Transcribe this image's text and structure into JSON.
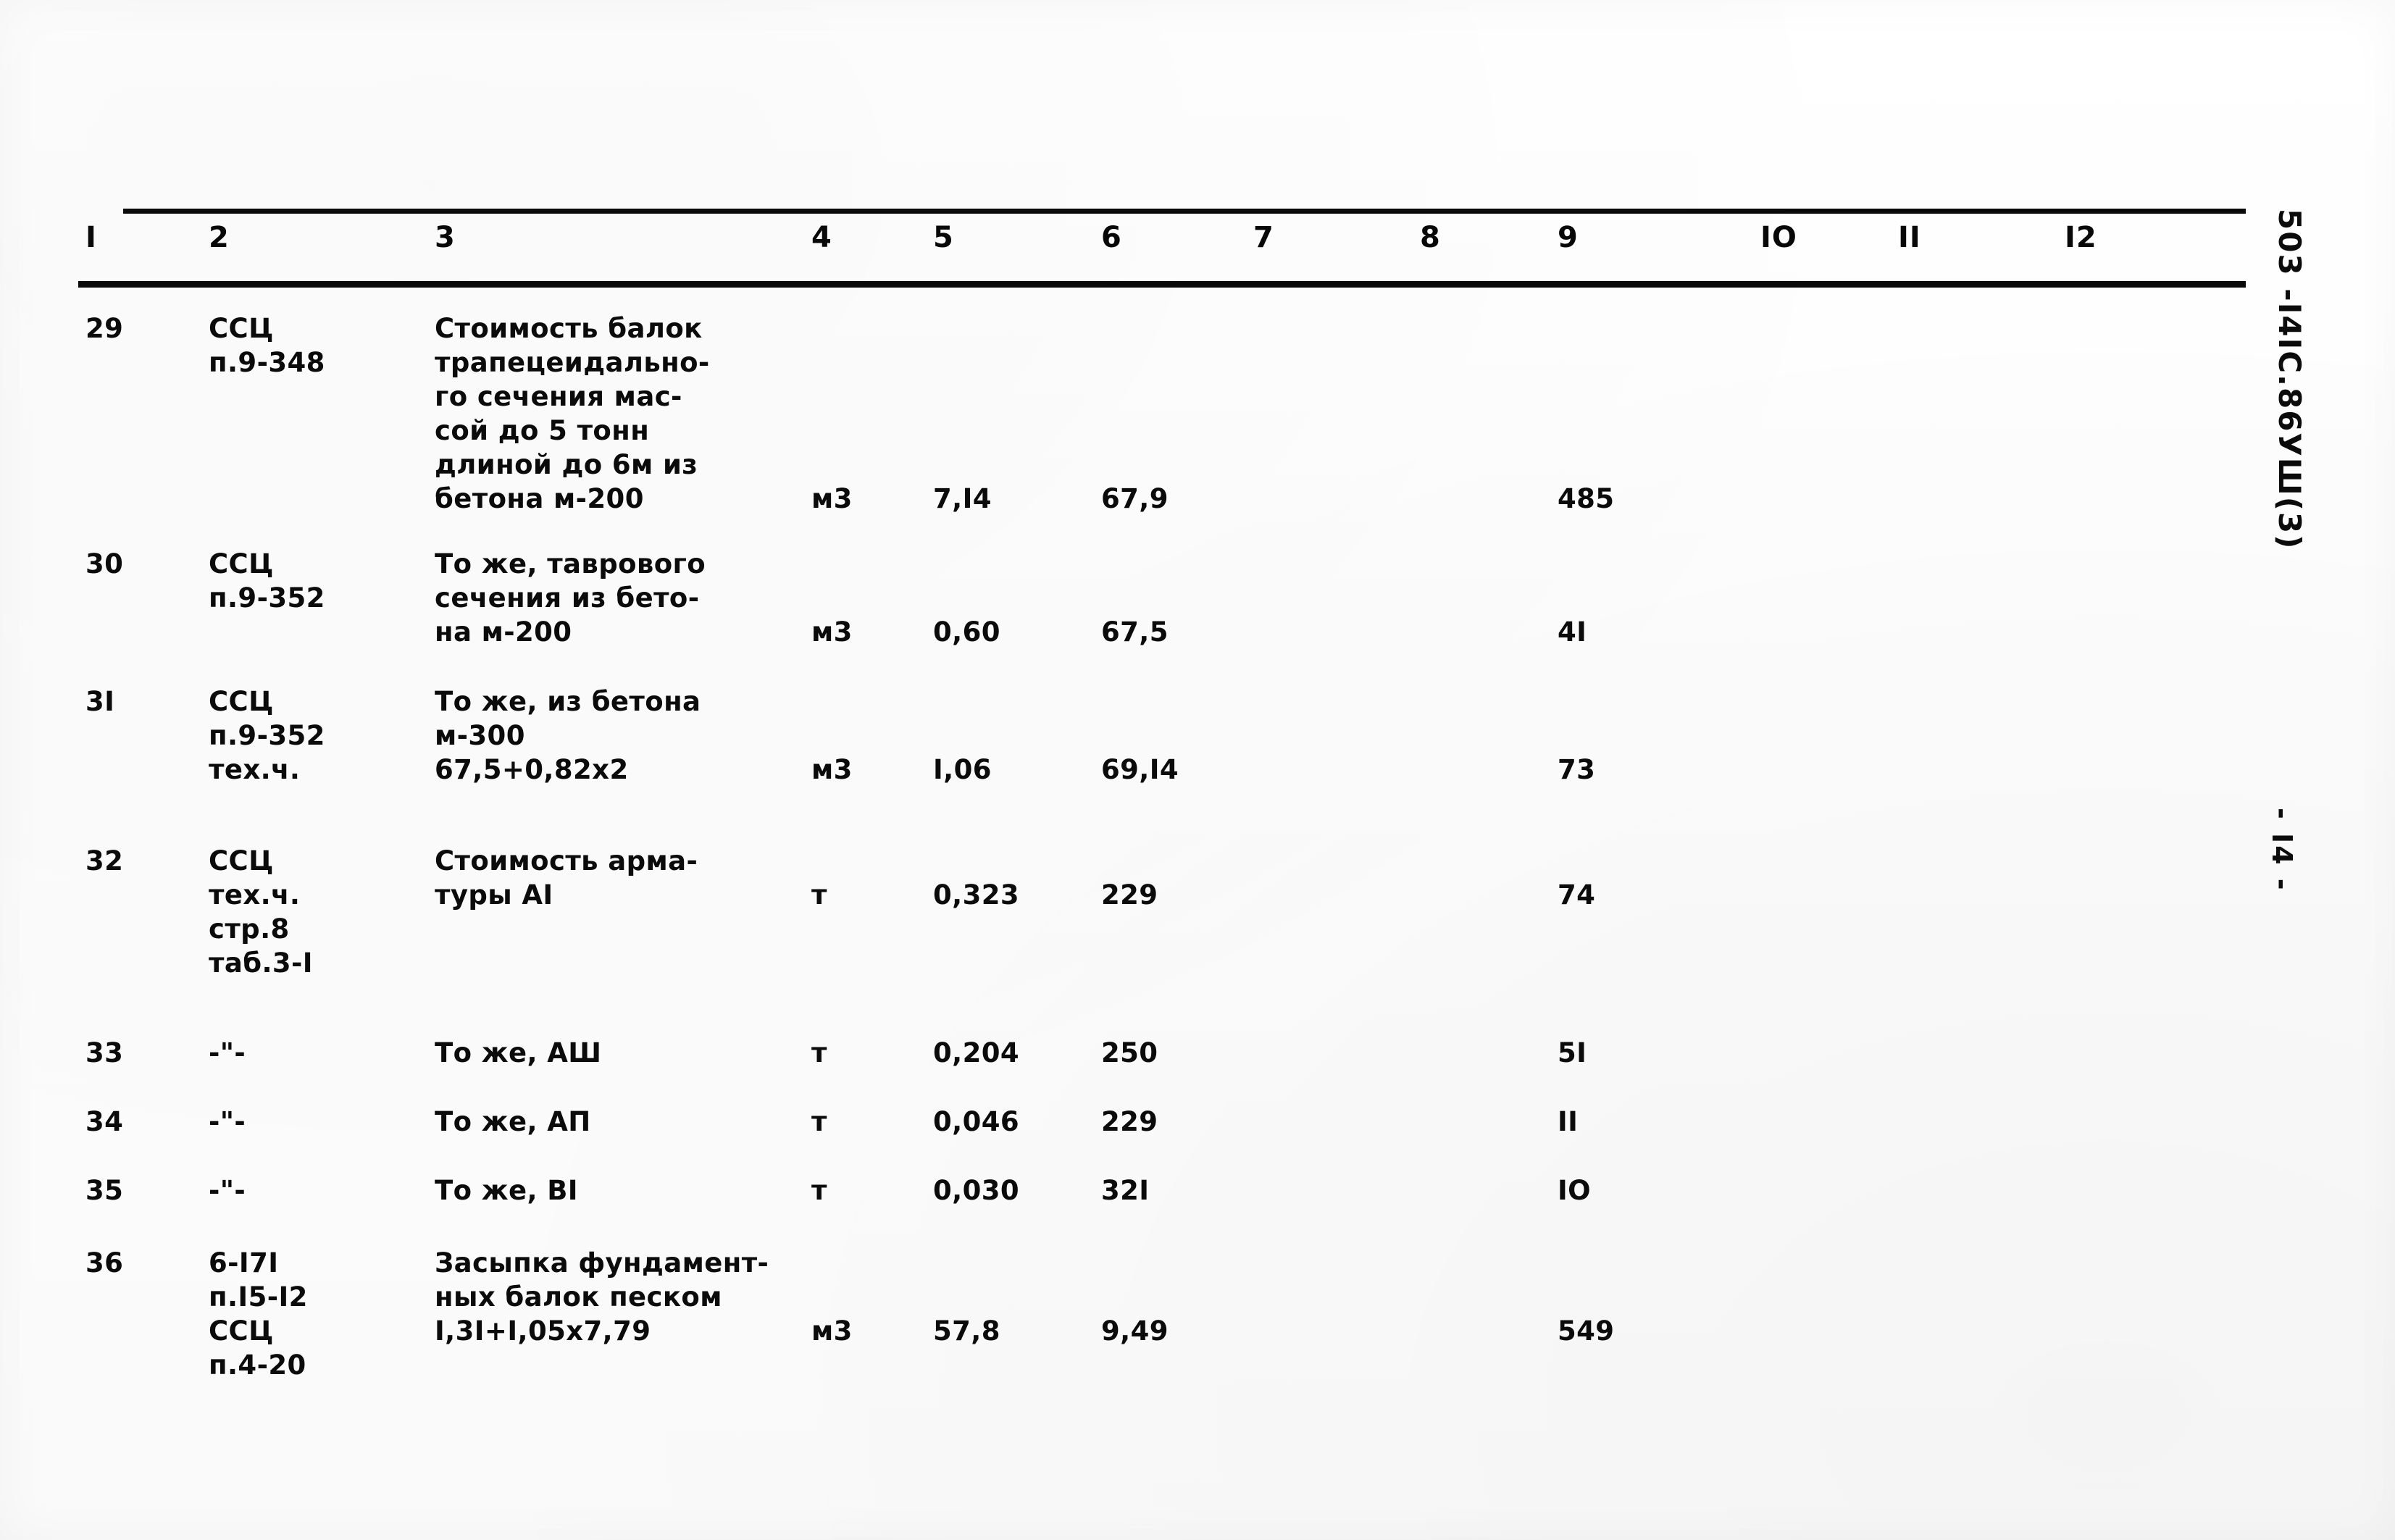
{
  "document": {
    "vertical_code": "503 -I4IC.86УШ(3)",
    "page_marker": "- I4 -"
  },
  "table": {
    "column_headers": [
      "I",
      "2",
      "3",
      "4",
      "5",
      "6",
      "7",
      "8",
      "9",
      "IO",
      "II",
      "I2"
    ],
    "rows": [
      {
        "num": "29",
        "code": "ССЦ\nп.9-348",
        "description": "Стоимость балок\nтрапецеидально-\nго сечения мас-\nсой до 5 тонн\nдлиной до 6м из\nбетона м-200",
        "unit": "м3",
        "c5": "7,I4",
        "c6": "67,9",
        "c7": "",
        "c8": "",
        "c9": "485",
        "c10": "",
        "c11": "",
        "c12": "",
        "desc_line_of_values": 5
      },
      {
        "num": "30",
        "code": "ССЦ\nп.9-352",
        "description": "То же, таврового\nсечения из бето-\nна м-200",
        "unit": "м3",
        "c5": "0,60",
        "c6": "67,5",
        "c7": "",
        "c8": "",
        "c9": "4I",
        "c10": "",
        "c11": "",
        "c12": "",
        "desc_line_of_values": 2
      },
      {
        "num": "3I",
        "code": "ССЦ\nп.9-352\nтех.ч.",
        "description": "То же, из бетона\nм-300\n67,5+0,82x2",
        "unit": "м3",
        "c5": "I,06",
        "c6": "69,I4",
        "c7": "",
        "c8": "",
        "c9": "73",
        "c10": "",
        "c11": "",
        "c12": "",
        "desc_line_of_values": 2
      },
      {
        "num": "32",
        "code": "ССЦ\nтех.ч.\nстр.8\nтаб.3-I",
        "description": "Стоимость арма-\nтуры АI",
        "unit": "т",
        "c5": "0,323",
        "c6": "229",
        "c7": "",
        "c8": "",
        "c9": "74",
        "c10": "",
        "c11": "",
        "c12": "",
        "desc_line_of_values": 1
      },
      {
        "num": "33",
        "code": "-\"-",
        "description": "То же, АШ",
        "unit": "т",
        "c5": "0,204",
        "c6": "250",
        "c7": "",
        "c8": "",
        "c9": "5I",
        "c10": "",
        "c11": "",
        "c12": "",
        "desc_line_of_values": 0
      },
      {
        "num": "34",
        "code": "-\"-",
        "description": "То же, АП",
        "unit": "т",
        "c5": "0,046",
        "c6": "229",
        "c7": "",
        "c8": "",
        "c9": "II",
        "c10": "",
        "c11": "",
        "c12": "",
        "desc_line_of_values": 0
      },
      {
        "num": "35",
        "code": "-\"-",
        "description": "То же, ВI",
        "unit": "т",
        "c5": "0,030",
        "c6": "32I",
        "c7": "",
        "c8": "",
        "c9": "IO",
        "c10": "",
        "c11": "",
        "c12": "",
        "desc_line_of_values": 0
      },
      {
        "num": "36",
        "code": "6-I7I\nп.I5-I2\nССЦ\nп.4-20",
        "description": "Засыпка фундамент-\nных балок песком\nI,3I+I,05x7,79",
        "unit": "м3",
        "c5": "57,8",
        "c6": "9,49",
        "c7": "",
        "c8": "",
        "c9": "549",
        "c10": "",
        "c11": "",
        "c12": "",
        "desc_line_of_values": 2
      }
    ]
  },
  "layout": {
    "column_header_x": [
      118,
      288,
      600,
      1120,
      1288,
      1520,
      1730,
      1960,
      2150,
      2430,
      2620,
      2850
    ],
    "row_tops": [
      0,
      325,
      515,
      735,
      1000,
      1095,
      1190,
      1290
    ],
    "line_height": 47
  }
}
